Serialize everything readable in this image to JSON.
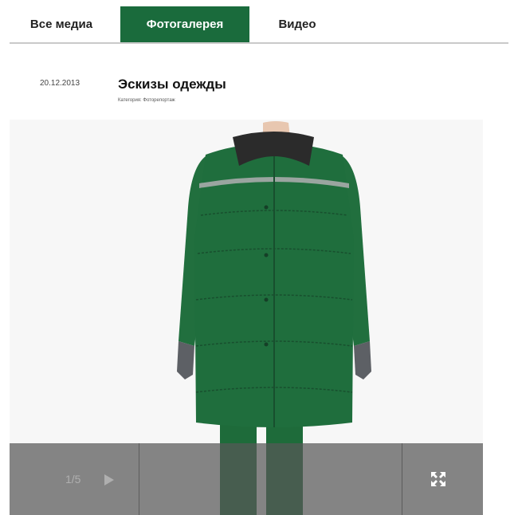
{
  "tabs": [
    {
      "label": "Все медиа",
      "active": false
    },
    {
      "label": "Фотогалерея",
      "active": true
    },
    {
      "label": "Видео",
      "active": false
    }
  ],
  "post": {
    "date": "20.12.2013",
    "title": "Эскизы одежды",
    "category": "Категория: Фоторепортаж"
  },
  "gallery": {
    "counter": "1/5",
    "play_icon": "play-icon",
    "fullscreen_icon": "fullscreen-icon"
  },
  "colors": {
    "accent": "#1a6b3c",
    "coat": "#1f6e3d",
    "control_bar": "#585858"
  }
}
